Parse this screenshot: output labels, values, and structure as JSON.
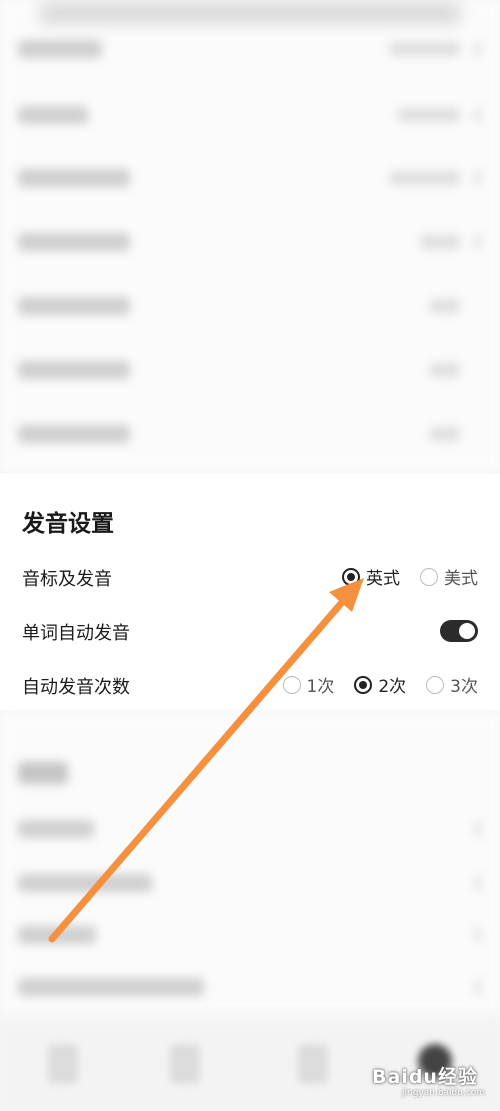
{
  "sound_settings": {
    "title": "发音设置",
    "phonetic": {
      "label": "音标及发音",
      "options": [
        {
          "label": "英式",
          "selected": true
        },
        {
          "label": "美式",
          "selected": false
        }
      ]
    },
    "auto_play": {
      "label": "单词自动发音",
      "enabled": true
    },
    "play_count": {
      "label": "自动发音次数",
      "options": [
        {
          "label": "1次",
          "selected": false
        },
        {
          "label": "2次",
          "selected": true
        },
        {
          "label": "3次",
          "selected": false
        }
      ]
    }
  },
  "watermark": {
    "text": "Baidu经验",
    "subtext": "jingyan.baidu.com"
  },
  "colors": {
    "arrow": "#f5913e",
    "toggle_on": "#2b2b2b"
  }
}
